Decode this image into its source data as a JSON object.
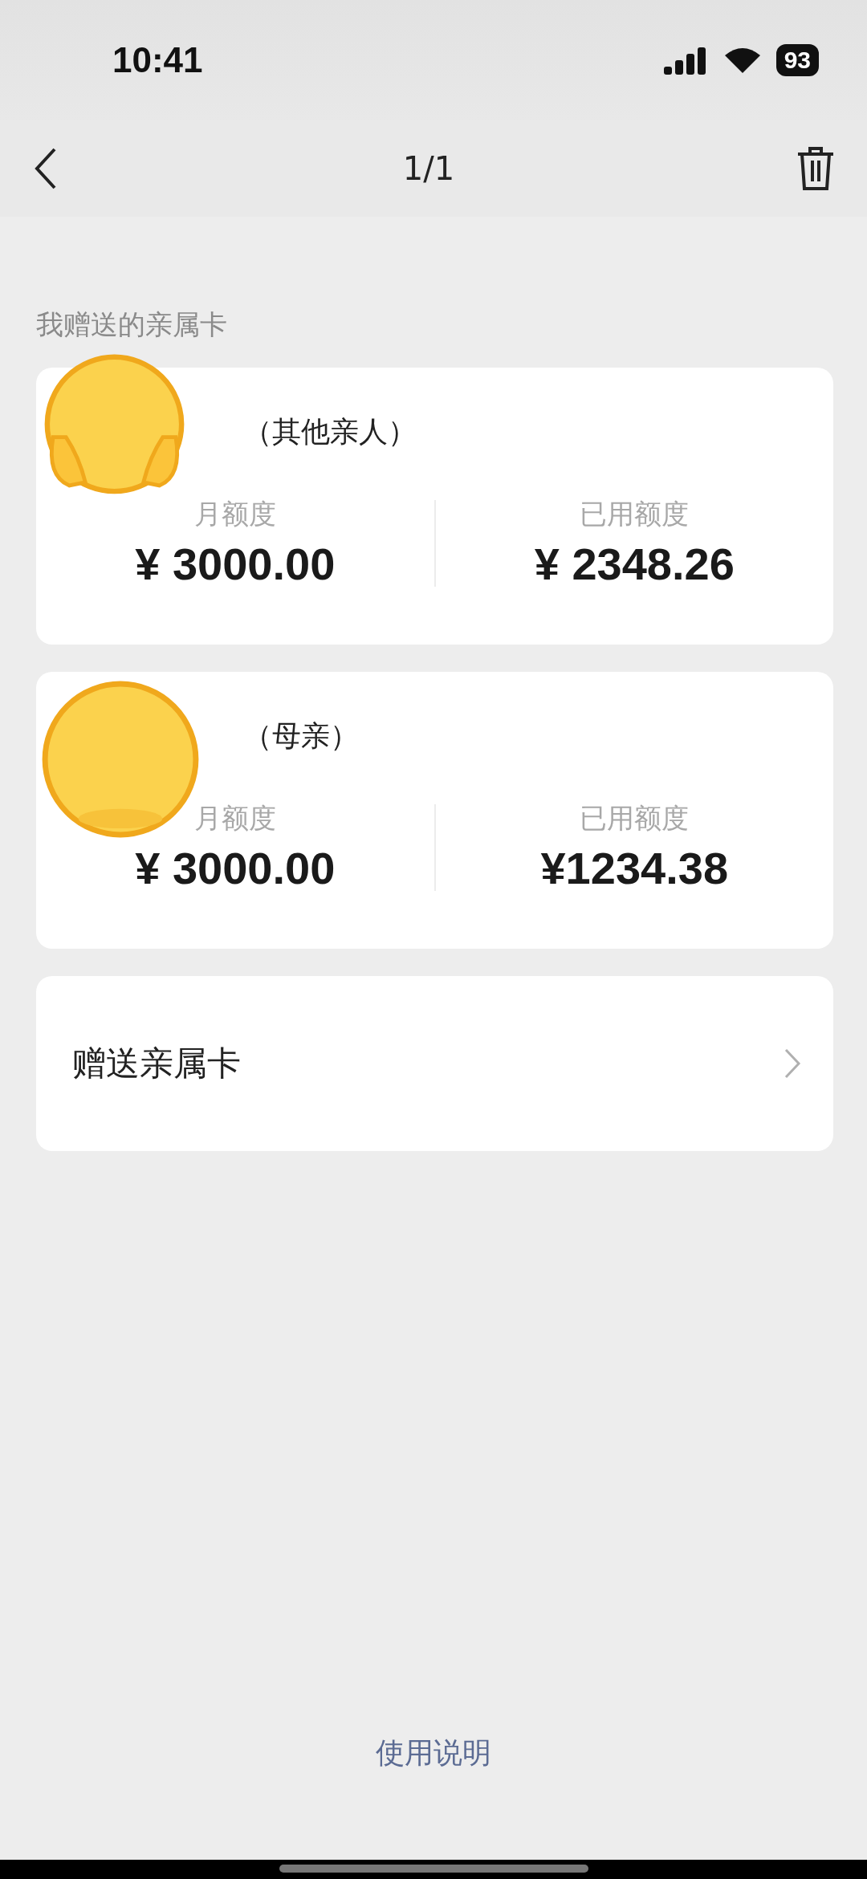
{
  "status_bar": {
    "time": "10:41",
    "battery": "93"
  },
  "nav": {
    "title": "1/1"
  },
  "section_title": "我赠送的亲属卡",
  "cards": [
    {
      "relation": "（其他亲人）",
      "limit_label": "月额度",
      "limit": "¥ 3000.00",
      "used_label": "已用额度",
      "used": "¥ 2348.26"
    },
    {
      "relation": "（母亲）",
      "limit_label": "月额度",
      "limit": "¥ 3000.00",
      "used_label": "已用额度",
      "used": "¥1234.38"
    }
  ],
  "action": {
    "label": "赠送亲属卡"
  },
  "footer_link": "使用说明"
}
